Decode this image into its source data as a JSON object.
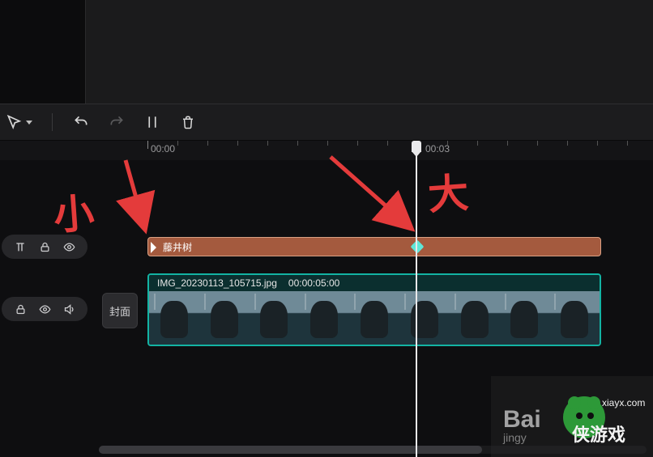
{
  "toolbar": {
    "select_tool": "select",
    "undo": "undo",
    "redo": "redo",
    "split": "split",
    "delete": "delete"
  },
  "ruler": {
    "labels": [
      "00:00",
      "00:03"
    ]
  },
  "tracks": {
    "text": {
      "clip_label": "藤井树"
    },
    "video": {
      "cover_button": "封面",
      "clip_filename": "IMG_20230113_105715.jpg",
      "clip_duration": "00:00:05:00"
    }
  },
  "annotations": {
    "small": "小",
    "big": "大"
  },
  "watermark": {
    "sub1": "jingy",
    "site": "xiayx.com",
    "brand": "侠游戏"
  }
}
